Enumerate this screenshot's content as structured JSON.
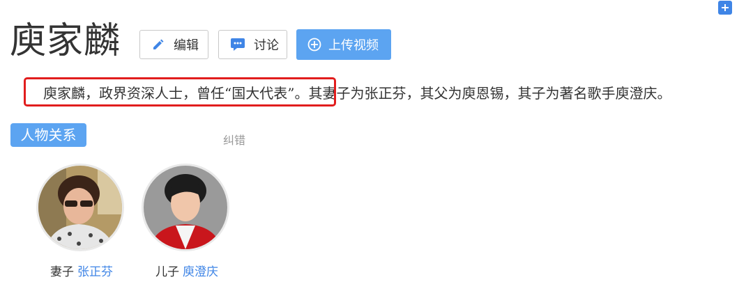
{
  "page": {
    "title": "庾家麟",
    "buttons": {
      "edit_label": "编辑",
      "discuss_label": "讨论",
      "upload_label": "上传视频"
    },
    "summary": "庾家麟，政界资深人士，曾任“国大代表”。其妻子为张正芬，其父为庾恩锡，其子为著名歌手庾澄庆。"
  },
  "relations": {
    "section_label": "人物关系",
    "correct_label": "纠错",
    "items": [
      {
        "relation": "妻子",
        "name": "张正芬",
        "icon": "person-photo-icon"
      },
      {
        "relation": "儿子",
        "name": "庾澄庆",
        "icon": "person-photo-icon"
      }
    ]
  },
  "colors": {
    "accent": "#5ca4f1",
    "link": "#3f85e6",
    "highlight": "#e11d1d"
  }
}
